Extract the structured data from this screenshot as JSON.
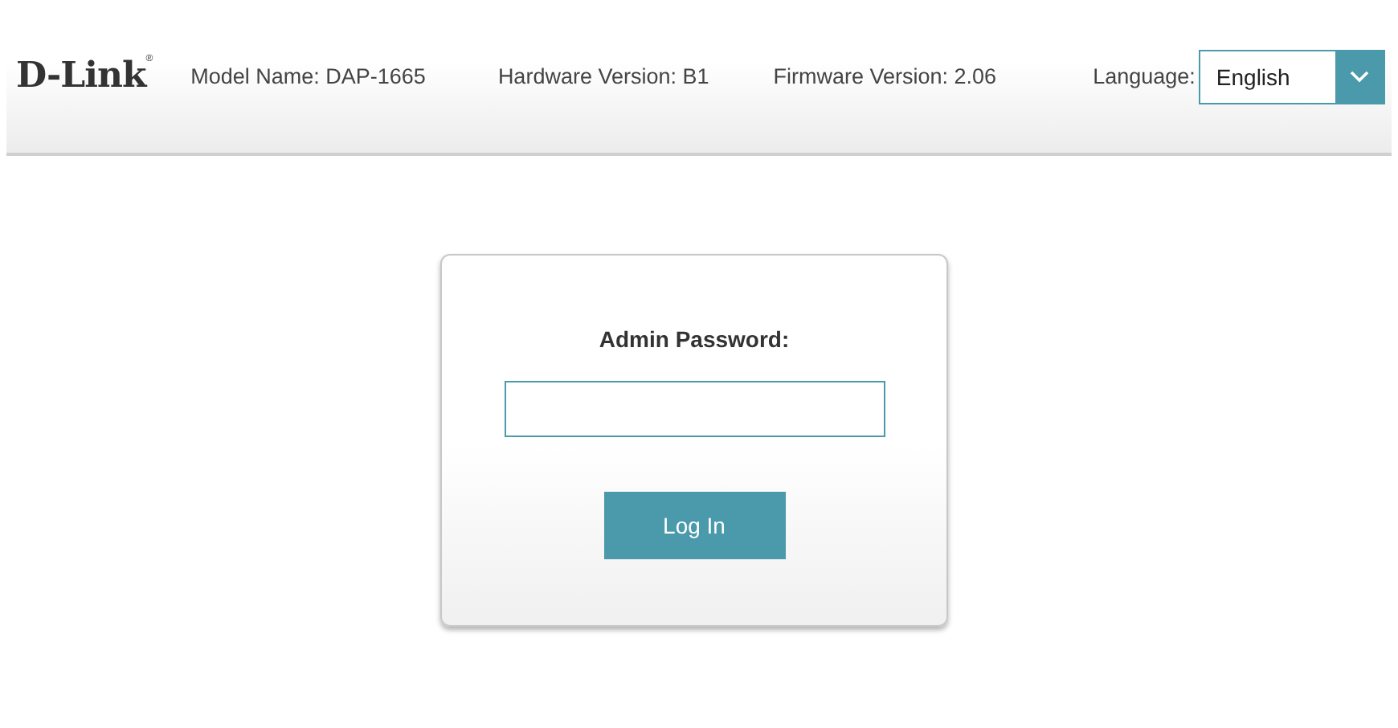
{
  "header": {
    "logo": "D-Link$^{®}$",
    "model_name": "Model Name: DAP-1665",
    "hardware_version": "Hardware Version: B1",
    "firmware_version": "Firmware Version: 2.06",
    "language_label": "Language:",
    "language_value": "English"
  },
  "login": {
    "label": "Admin Password:",
    "button": "Log In"
  }
}
